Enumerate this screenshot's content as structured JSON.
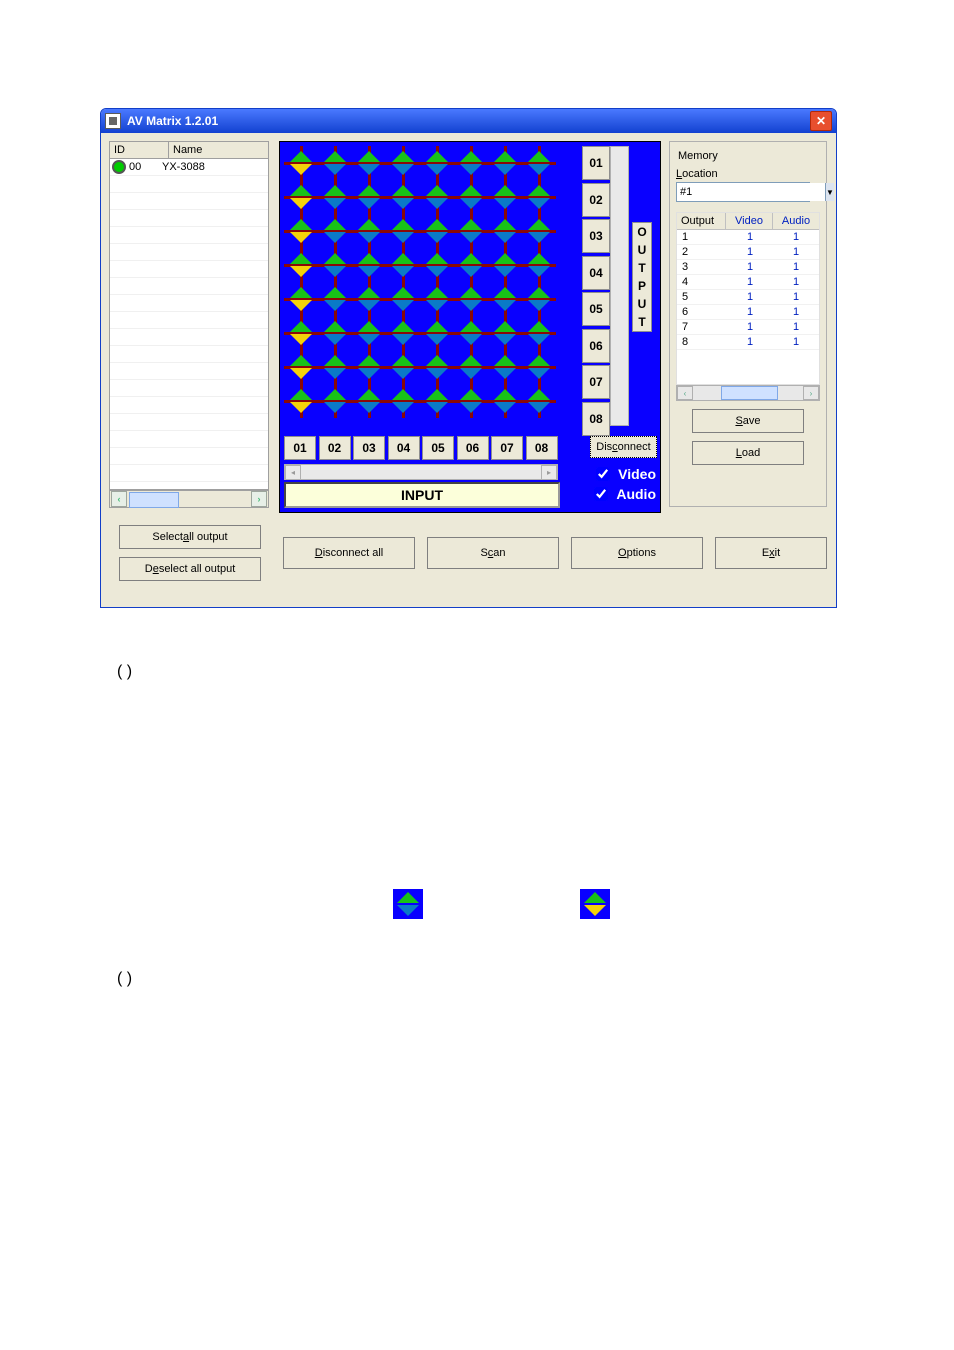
{
  "window": {
    "title": "AV Matrix 1.2.01",
    "close_icon": "✕"
  },
  "list": {
    "hdr_id": "ID",
    "hdr_name": "Name",
    "row_id": "00",
    "row_name": "YX-3088"
  },
  "selection_col1": [
    true,
    true,
    true,
    true,
    true,
    true,
    true,
    true
  ],
  "out_labels": [
    "01",
    "02",
    "03",
    "04",
    "05",
    "06",
    "07",
    "08"
  ],
  "in_labels": [
    "01",
    "02",
    "03",
    "04",
    "05",
    "06",
    "07",
    "08"
  ],
  "out_vlabel": "OUTPUT",
  "input_label": "INPUT",
  "disconnect_btn": "Disconnect",
  "chk_video": "Video",
  "chk_audio": "Audio",
  "memory": {
    "legend": "Memory",
    "location_lbl": "Location",
    "location_val": "#1",
    "hdr_output": "Output",
    "hdr_video": "Video",
    "hdr_audio": "Audio",
    "rows": [
      {
        "o": "1",
        "v": "1",
        "a": "1"
      },
      {
        "o": "2",
        "v": "1",
        "a": "1"
      },
      {
        "o": "3",
        "v": "1",
        "a": "1"
      },
      {
        "o": "4",
        "v": "1",
        "a": "1"
      },
      {
        "o": "5",
        "v": "1",
        "a": "1"
      },
      {
        "o": "6",
        "v": "1",
        "a": "1"
      },
      {
        "o": "7",
        "v": "1",
        "a": "1"
      },
      {
        "o": "8",
        "v": "1",
        "a": "1"
      }
    ],
    "save": "Save",
    "load": "Load"
  },
  "buttons": {
    "select_all": "Select all output",
    "deselect_all": "Deselect all output",
    "disconnect_all": "Disconnect all",
    "scan": "Scan",
    "options": "Options",
    "exit": "Exit"
  },
  "paren1": "(   )",
  "paren2": "(   )"
}
